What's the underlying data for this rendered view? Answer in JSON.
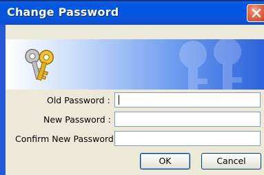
{
  "window": {
    "title": "Change Password"
  },
  "fields": [
    {
      "label": "Old Password :",
      "value": "",
      "placeholder": ""
    },
    {
      "label": "New Password :",
      "value": "",
      "placeholder": ""
    },
    {
      "label": "Confirm New Password :",
      "value": "",
      "placeholder": ""
    }
  ],
  "buttons": {
    "ok_label": "OK",
    "cancel_label": "Cancel"
  },
  "icons": {
    "close": "close-icon",
    "banner": "keys-icon",
    "watermark": "keys-watermark-icon"
  },
  "colors": {
    "title_bar": "#0058e6",
    "close_button": "#e56a4c",
    "dialog_background": "#ece9d8",
    "input_border": "#7f9db9",
    "key_gold": "#e5b21b",
    "key_silver": "#c0c0c0"
  }
}
